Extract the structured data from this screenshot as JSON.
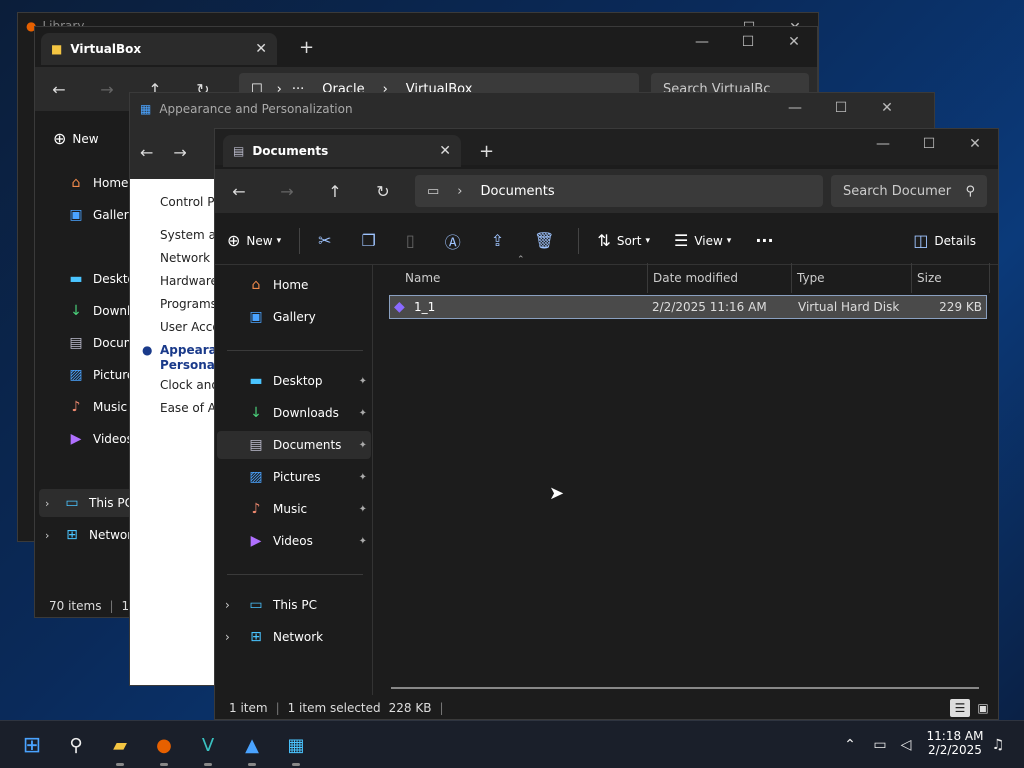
{
  "windows": {
    "library": {
      "title": "Library"
    },
    "virtualbox": {
      "tab_title": "VirtualBox",
      "breadcrumb": [
        "Oracle",
        "VirtualBox"
      ],
      "search_placeholder": "Search VirtualBc",
      "new_label": "New",
      "nav": [
        "Home",
        "Gallery",
        "Desktop",
        "Downlo",
        "Docum",
        "Pictures",
        "Music",
        "Videos",
        "This PC",
        "Networ"
      ],
      "status": "70 items",
      "status2": "1 it"
    },
    "appearance": {
      "title": "Appearance and Personalization",
      "items": [
        "Control Pa",
        "System an",
        "Network a",
        "Hardware",
        "Programs",
        "User Acco",
        "Appearanc",
        "Personaliz",
        "Clock and",
        "Ease of Ac"
      ]
    },
    "documents": {
      "tab_title": "Documents",
      "address": "Documents",
      "search_placeholder": "Search Documer",
      "toolbar": {
        "new_label": "New",
        "sort_label": "Sort",
        "view_label": "View",
        "details_label": "Details"
      },
      "nav": {
        "home": "Home",
        "gallery": "Gallery",
        "desktop": "Desktop",
        "downloads": "Downloads",
        "documents": "Documents",
        "pictures": "Pictures",
        "music": "Music",
        "videos": "Videos",
        "this_pc": "This PC",
        "network": "Network"
      },
      "columns": {
        "name": "Name",
        "date": "Date modified",
        "type": "Type",
        "size": "Size"
      },
      "files": [
        {
          "name": "1_1",
          "date": "2/2/2025 11:16 AM",
          "type": "Virtual Hard Disk",
          "size": "229 KB"
        }
      ],
      "status": {
        "count": "1 item",
        "selected": "1 item selected",
        "size": "228 KB"
      }
    }
  },
  "taskbar": {
    "time": "11:18 AM",
    "date": "2/2/2025",
    "apps": [
      "start-icon",
      "search-icon",
      "file-explorer-icon",
      "firefox-icon",
      "vscode-icon",
      "photos-icon",
      "control-panel-icon"
    ]
  },
  "colors": {
    "accent": "#9fc4ff",
    "window_bg": "#1c1c1c",
    "selection": "#4a4a4a"
  }
}
